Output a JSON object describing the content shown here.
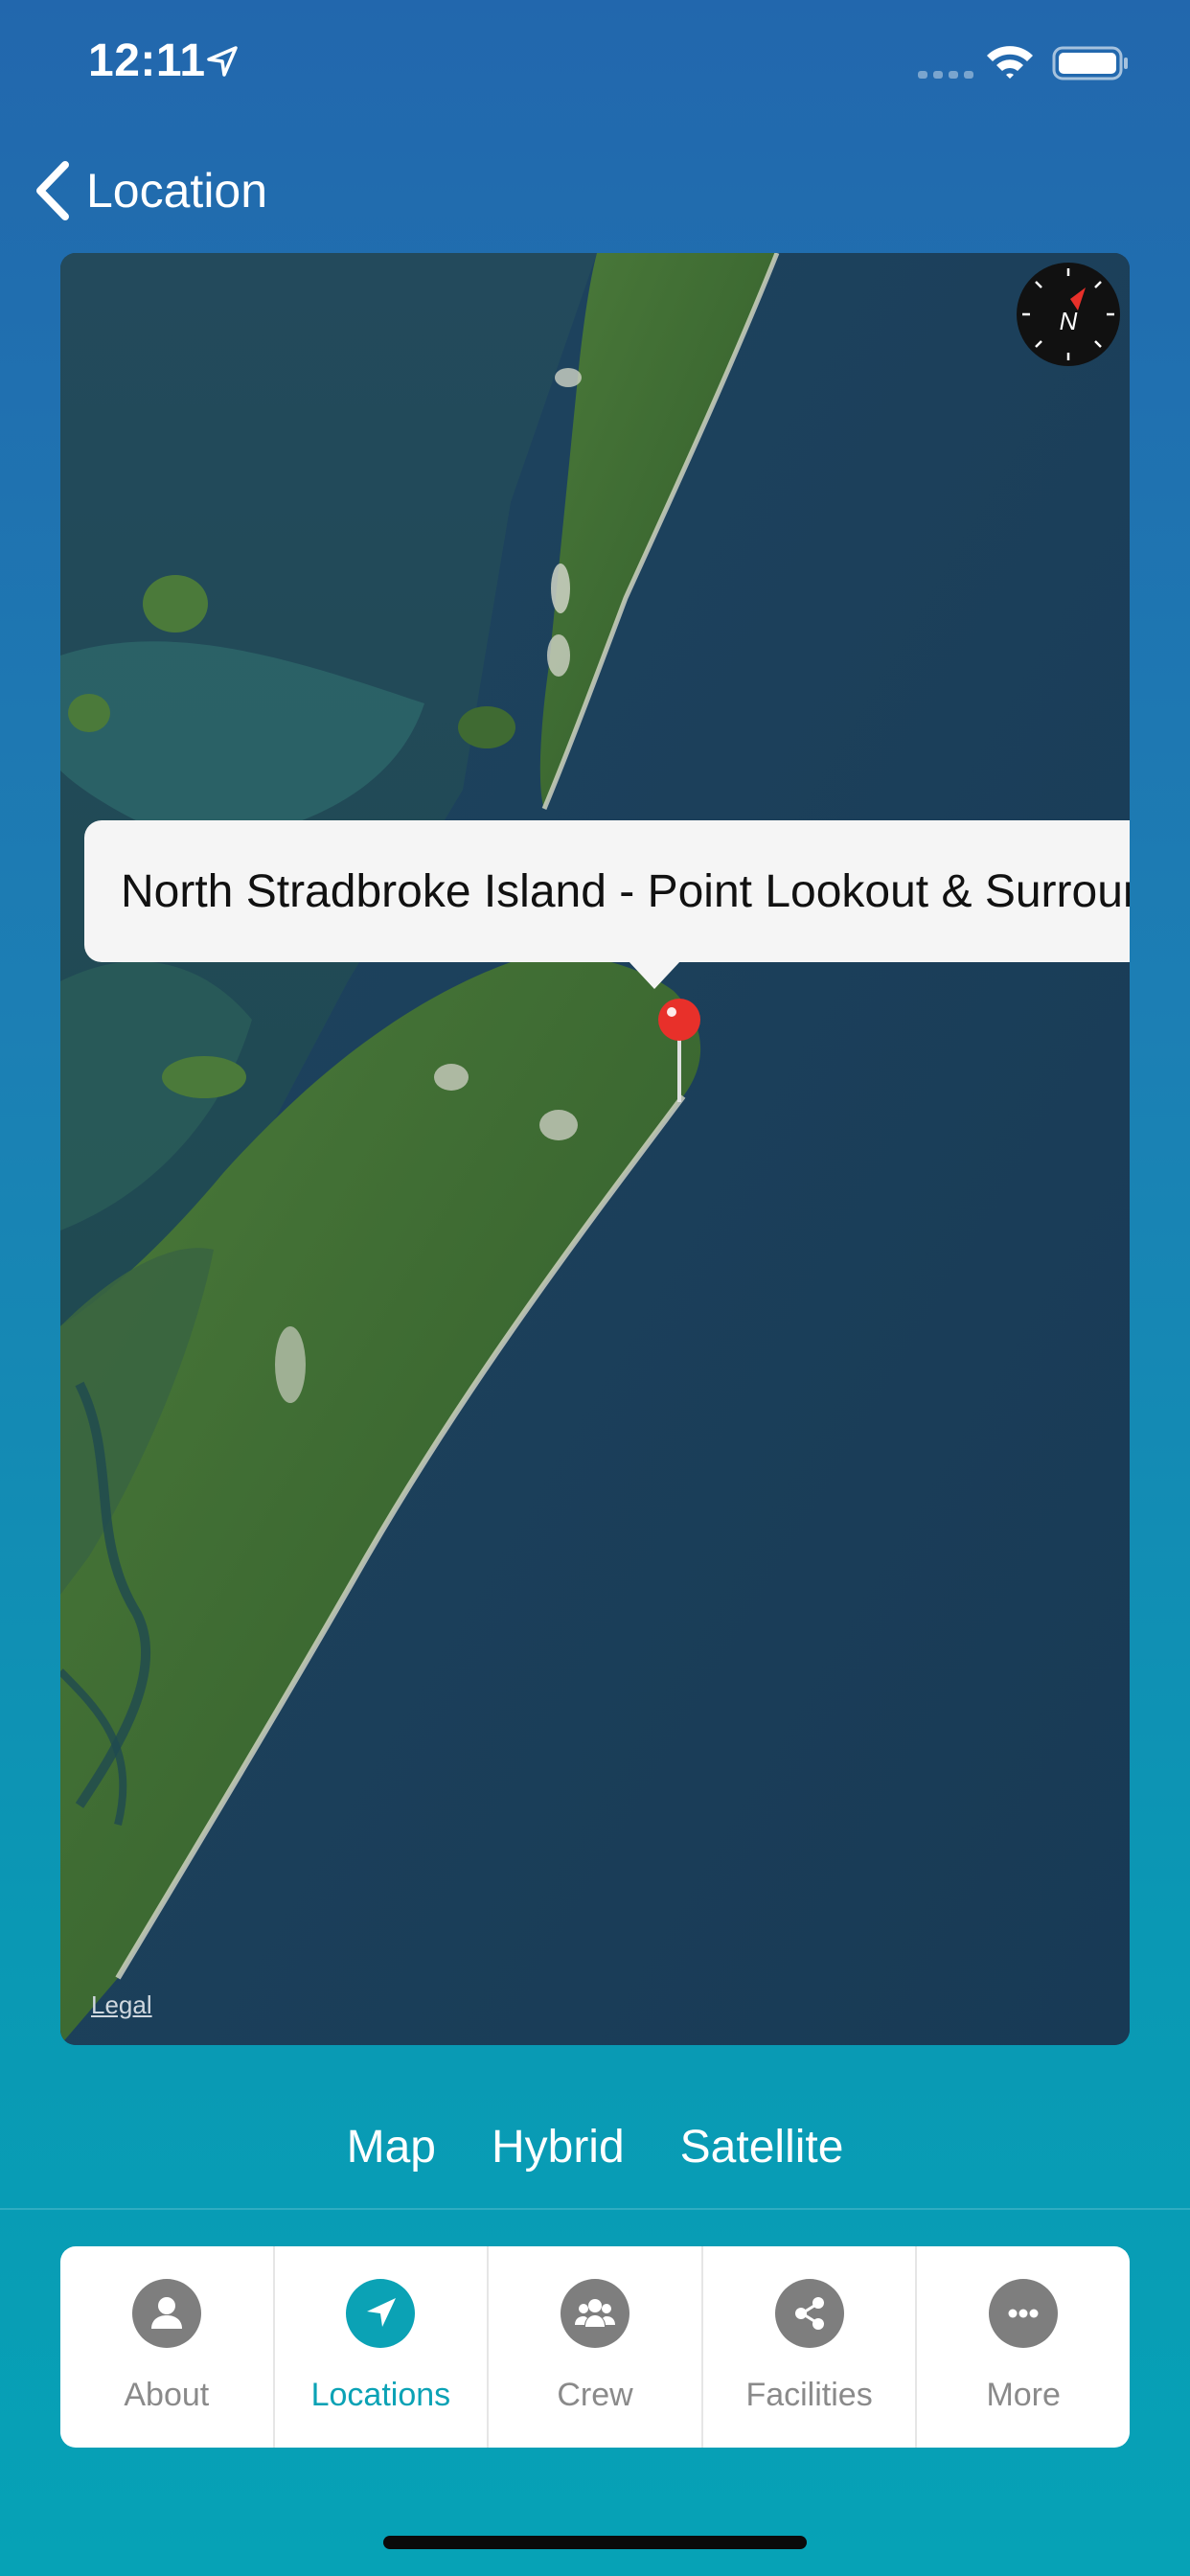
{
  "status_bar": {
    "time": "12:11",
    "icons": [
      "location-arrow-icon",
      "signal-icon",
      "wifi-icon",
      "battery-icon"
    ]
  },
  "nav": {
    "back_icon": "chevron-left-icon",
    "title": "Location"
  },
  "map": {
    "callout_text": "North Stradbroke Island - Point Lookout & Surrounds",
    "legal_label": "Legal",
    "compass_label": "N",
    "pin_icon": "map-pin-icon",
    "colors": {
      "water": "#1b3d59",
      "land": "#3f6a32",
      "pin": "#e8302a"
    }
  },
  "map_type": {
    "options": [
      "Map",
      "Hybrid",
      "Satellite"
    ]
  },
  "tabs": [
    {
      "label": "About",
      "icon": "person-icon",
      "active": false
    },
    {
      "label": "Locations",
      "icon": "navigation-arrow-icon",
      "active": true
    },
    {
      "label": "Crew",
      "icon": "group-icon",
      "active": false
    },
    {
      "label": "Facilities",
      "icon": "share-icon",
      "active": false
    },
    {
      "label": "More",
      "icon": "more-dots-icon",
      "active": false
    }
  ],
  "colors": {
    "accent": "#0ba2b5",
    "inactive_tab": "#8a8a8a",
    "background_top": "#2267ad",
    "background_bottom": "#06a2b6"
  }
}
